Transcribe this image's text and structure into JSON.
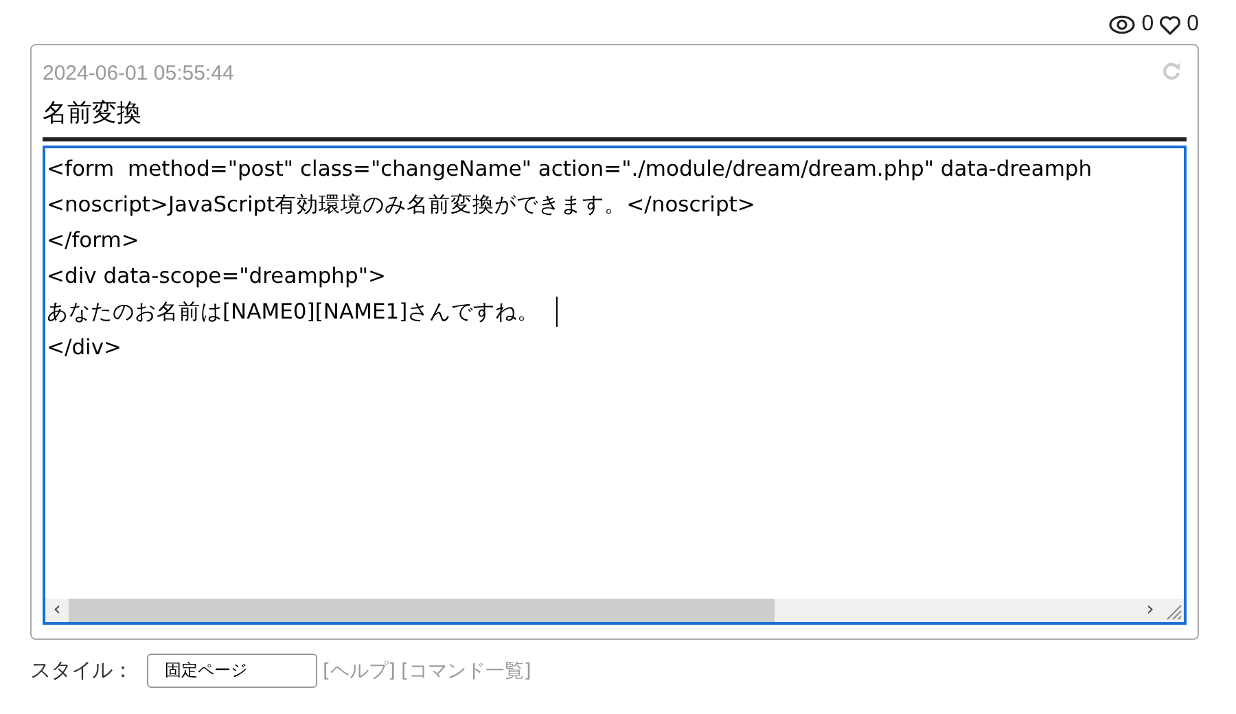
{
  "stats": {
    "views": "0",
    "likes": "0"
  },
  "post": {
    "timestamp": "2024-06-01 05:55:44",
    "title": "名前変換",
    "editor": {
      "lines": [
        {
          "text": "<form  method=\"post\" class=\"changeName\" action=\"./module/dream/dream.php\" data-dreamph",
          "caret": false
        },
        {
          "text": "<noscript>JavaScript有効環境のみ名前変換ができます。</noscript>",
          "caret": false
        },
        {
          "text": "</form>",
          "caret": false
        },
        {
          "text": "<div data-scope=\"dreamphp\">",
          "caret": false
        },
        {
          "text": "あなたのお名前は[NAME0][NAME1]さんですね。",
          "caret": true
        },
        {
          "text": "</div>",
          "caret": false
        }
      ],
      "scroll_left": "‹",
      "scroll_right": "›"
    }
  },
  "footer": {
    "style_label": "スタイル：",
    "style_value": "固定ページ",
    "links": [
      "[ヘルプ]",
      "[コマンド一覧]"
    ]
  }
}
